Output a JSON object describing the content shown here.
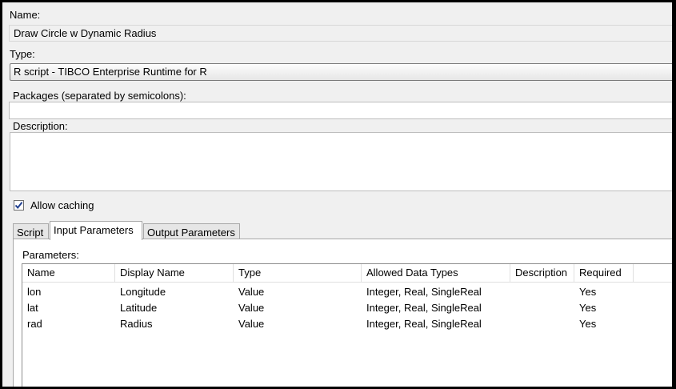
{
  "form": {
    "name_label": "Name:",
    "name_value": "Draw Circle w Dynamic Radius",
    "type_label": "Type:",
    "type_value": "R script - TIBCO Enterprise Runtime for R",
    "packages_label": "Packages (separated by semicolons):",
    "packages_value": "",
    "description_label": "Description:",
    "description_value": "",
    "allow_caching_label": "Allow caching",
    "allow_caching_checked": true
  },
  "tabs": [
    {
      "label": "Script",
      "active": false
    },
    {
      "label": "Input Parameters",
      "active": true
    },
    {
      "label": "Output Parameters",
      "active": false
    }
  ],
  "params": {
    "label": "Parameters:",
    "columns": [
      "Name",
      "Display Name",
      "Type",
      "Allowed Data Types",
      "Description",
      "Required"
    ],
    "rows": [
      [
        "lon",
        "Longitude",
        "Value",
        "Integer, Real, SingleReal",
        "",
        "Yes"
      ],
      [
        "lat",
        "Latitude",
        "Value",
        "Integer, Real, SingleReal",
        "",
        "Yes"
      ],
      [
        "rad",
        "Radius",
        "Value",
        "Integer, Real, SingleReal",
        "",
        "Yes"
      ]
    ]
  }
}
